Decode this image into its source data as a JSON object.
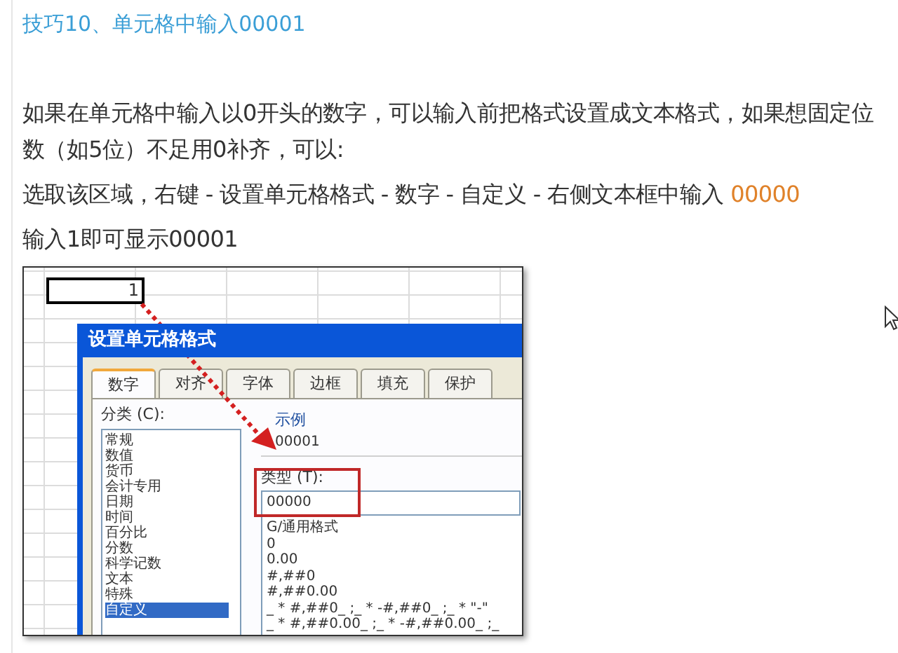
{
  "article": {
    "title": "技巧10、单元格中输入00001",
    "intro": "如果在单元格中输入以0开头的数字，可以输入前把格式设置成文本格式，如果想固定位数（如5位）不足用0补齐，可以:",
    "steps": {
      "text": "选取该区域，右键 - 设置单元格格式 - 数字 - 自定义 - 右侧文本框中输入",
      "highlight": "00000"
    },
    "result": "输入1即可显示00001"
  },
  "screenshot": {
    "cell_value": "1",
    "dialog": {
      "title": "设置单元格格式",
      "tabs": [
        {
          "label": "数字",
          "selected": true
        },
        {
          "label": "对齐",
          "selected": false
        },
        {
          "label": "字体",
          "selected": false
        },
        {
          "label": "边框",
          "selected": false
        },
        {
          "label": "填充",
          "selected": false
        },
        {
          "label": "保护",
          "selected": false
        }
      ],
      "category_label": "分类 (C):",
      "categories": [
        {
          "label": "常规",
          "selected": false
        },
        {
          "label": "数值",
          "selected": false
        },
        {
          "label": "货币",
          "selected": false
        },
        {
          "label": "会计专用",
          "selected": false
        },
        {
          "label": "日期",
          "selected": false
        },
        {
          "label": "时间",
          "selected": false
        },
        {
          "label": "百分比",
          "selected": false
        },
        {
          "label": "分数",
          "selected": false
        },
        {
          "label": "科学记数",
          "selected": false
        },
        {
          "label": "文本",
          "selected": false
        },
        {
          "label": "特殊",
          "selected": false
        },
        {
          "label": "自定义",
          "selected": true
        }
      ],
      "sample_label": "示例",
      "sample_value": "00001",
      "type_label": "类型 (T):",
      "type_value": "00000",
      "formats": [
        "G/通用格式",
        "0",
        "0.00",
        "#,##0",
        "#,##0.00",
        "_ * #,##0_ ;_ * -#,##0_ ;_ * \"-\"",
        "_ * #,##0.00_ ;_ * -#,##0.00_ ;_"
      ]
    }
  }
}
